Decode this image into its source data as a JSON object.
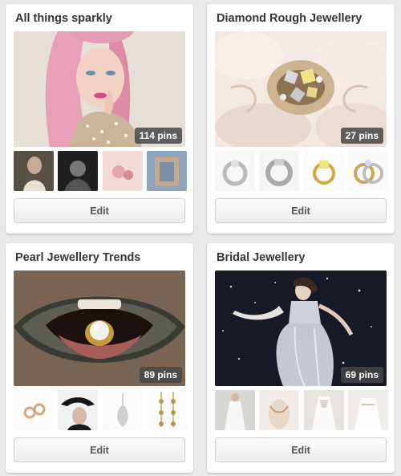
{
  "boards": [
    {
      "title": "All things sparkly",
      "pins": "114 pins",
      "edit_label": "Edit"
    },
    {
      "title": "Diamond Rough Jewellery",
      "pins": "27 pins",
      "edit_label": "Edit"
    },
    {
      "title": "Pearl Jewellery Trends",
      "pins": "89 pins",
      "edit_label": "Edit"
    },
    {
      "title": "Bridal Jewellery",
      "pins": "69 pins",
      "edit_label": "Edit"
    }
  ]
}
